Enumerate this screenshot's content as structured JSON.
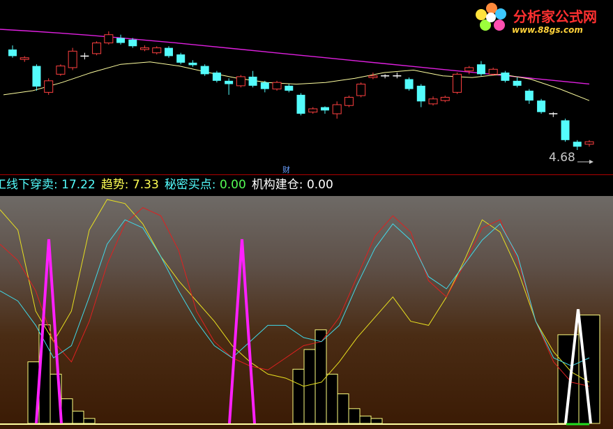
{
  "brand": {
    "name": "分析家公式网",
    "url": "www.88gs.com",
    "colors": {
      "name": "#ff3030",
      "url": "#ffd23a"
    }
  },
  "price_chart": {
    "last_price_label": "4.68",
    "marker_label": "财",
    "colors": {
      "up": "#ff4040",
      "down": "#54fcfc",
      "ma_long": "#e020e0",
      "ma_short": "#ffffa0",
      "ma_mid": "#e0e080",
      "separator": "#b00000"
    },
    "ma_long_values": [
      100,
      99.3,
      98.5,
      97.6,
      96.6,
      95.5,
      94.4,
      93.2,
      92.0,
      90.8,
      89.6,
      88.4,
      87.2,
      86.0,
      84.8,
      83.6,
      82.4,
      81.2,
      80.0,
      78.8,
      77.6
    ],
    "ma_short_values": [
      35,
      40,
      50,
      62,
      72,
      75,
      70,
      62,
      55,
      50,
      48,
      50,
      55,
      62,
      65,
      58,
      56,
      60,
      54,
      42,
      28
    ],
    "candles": [
      {
        "dir": "down",
        "o": 82,
        "c": 90,
        "h": 95,
        "l": 80
      },
      {
        "dir": "up",
        "o": 78,
        "c": 80,
        "h": 82,
        "l": 75
      },
      {
        "dir": "down",
        "o": 70,
        "c": 45,
        "h": 72,
        "l": 40
      },
      {
        "dir": "up",
        "o": 38,
        "c": 52,
        "h": 55,
        "l": 35
      },
      {
        "dir": "up",
        "o": 60,
        "c": 70,
        "h": 72,
        "l": 58
      },
      {
        "dir": "up",
        "o": 68,
        "c": 88,
        "h": 92,
        "l": 65
      },
      {
        "dir": "flat",
        "o": 82,
        "c": 82,
        "h": 86,
        "l": 78
      },
      {
        "dir": "up",
        "o": 85,
        "c": 98,
        "h": 100,
        "l": 83
      },
      {
        "dir": "up",
        "o": 98,
        "c": 108,
        "h": 112,
        "l": 96
      },
      {
        "dir": "down",
        "o": 104,
        "c": 98,
        "h": 108,
        "l": 96
      },
      {
        "dir": "down",
        "o": 102,
        "c": 94,
        "h": 104,
        "l": 92
      },
      {
        "dir": "up",
        "o": 92,
        "c": 90,
        "h": 95,
        "l": 88
      },
      {
        "dir": "up",
        "o": 86,
        "c": 92,
        "h": 94,
        "l": 84
      },
      {
        "dir": "down",
        "o": 92,
        "c": 82,
        "h": 94,
        "l": 80
      },
      {
        "dir": "down",
        "o": 84,
        "c": 74,
        "h": 86,
        "l": 72
      },
      {
        "dir": "down",
        "o": 74,
        "c": 71,
        "h": 77,
        "l": 69
      },
      {
        "dir": "down",
        "o": 70,
        "c": 60,
        "h": 72,
        "l": 58
      },
      {
        "dir": "down",
        "o": 62,
        "c": 52,
        "h": 64,
        "l": 50
      },
      {
        "dir": "down",
        "o": 52,
        "c": 48,
        "h": 55,
        "l": 35
      },
      {
        "dir": "up",
        "o": 46,
        "c": 57,
        "h": 59,
        "l": 44
      },
      {
        "dir": "down",
        "o": 57,
        "c": 46,
        "h": 64,
        "l": 44
      },
      {
        "dir": "down",
        "o": 50,
        "c": 42,
        "h": 52,
        "l": 38
      },
      {
        "dir": "up",
        "o": 42,
        "c": 50,
        "h": 52,
        "l": 40
      },
      {
        "dir": "down",
        "o": 46,
        "c": 40,
        "h": 48,
        "l": 38
      },
      {
        "dir": "down",
        "o": 35,
        "c": 12,
        "h": 37,
        "l": 10
      },
      {
        "dir": "up",
        "o": 14,
        "c": 18,
        "h": 20,
        "l": 12
      },
      {
        "dir": "down",
        "o": 20,
        "c": 16,
        "h": 21,
        "l": 12
      },
      {
        "dir": "up",
        "o": 12,
        "c": 23,
        "h": 27,
        "l": 6
      },
      {
        "dir": "up",
        "o": 22,
        "c": 32,
        "h": 34,
        "l": 20
      },
      {
        "dir": "up",
        "o": 34,
        "c": 48,
        "h": 50,
        "l": 32
      },
      {
        "dir": "up",
        "o": 56,
        "c": 58,
        "h": 62,
        "l": 54
      },
      {
        "dir": "flat",
        "o": 58,
        "c": 58,
        "h": 60,
        "l": 55
      },
      {
        "dir": "flat",
        "o": 58,
        "c": 58,
        "h": 62,
        "l": 55
      },
      {
        "dir": "down",
        "o": 54,
        "c": 42,
        "h": 56,
        "l": 40
      },
      {
        "dir": "down",
        "o": 46,
        "c": 27,
        "h": 48,
        "l": 20
      },
      {
        "dir": "up",
        "o": 24,
        "c": 30,
        "h": 33,
        "l": 22
      },
      {
        "dir": "up",
        "o": 28,
        "c": 32,
        "h": 34,
        "l": 26
      },
      {
        "dir": "up",
        "o": 38,
        "c": 60,
        "h": 62,
        "l": 36
      },
      {
        "dir": "up",
        "o": 64,
        "c": 68,
        "h": 70,
        "l": 60
      },
      {
        "dir": "down",
        "o": 72,
        "c": 60,
        "h": 76,
        "l": 58
      },
      {
        "dir": "up",
        "o": 60,
        "c": 66,
        "h": 68,
        "l": 58
      },
      {
        "dir": "down",
        "o": 62,
        "c": 52,
        "h": 64,
        "l": 50
      },
      {
        "dir": "down",
        "o": 52,
        "c": 46,
        "h": 56,
        "l": 44
      },
      {
        "dir": "down",
        "o": 40,
        "c": 28,
        "h": 42,
        "l": 24
      },
      {
        "dir": "down",
        "o": 28,
        "c": 14,
        "h": 30,
        "l": 12
      },
      {
        "dir": "flat",
        "o": 12,
        "c": 12,
        "h": 14,
        "l": 8
      },
      {
        "dir": "down",
        "o": 4,
        "c": -20,
        "h": 6,
        "l": -22
      },
      {
        "dir": "down",
        "o": -22,
        "c": -28,
        "h": -20,
        "l": -32
      },
      {
        "dir": "up",
        "o": -25,
        "c": -22,
        "h": -20,
        "l": -28
      }
    ]
  },
  "info_bar": [
    {
      "label": "工线下穿卖:",
      "value": "17.22",
      "label_color": "#54fcfc",
      "value_color": "#54fcfc"
    },
    {
      "label": "趋势:",
      "value": "7.33",
      "label_color": "#ffff54",
      "value_color": "#ffff54"
    },
    {
      "label": "秘密买点:",
      "value": "0.00",
      "label_color": "#54fcfc",
      "value_color": "#54fc54"
    },
    {
      "label": "机构建仓:",
      "value": "0.00",
      "label_color": "#ffffff",
      "value_color": "#ffffff"
    }
  ],
  "indicator": {
    "colors": {
      "red": "#e02020",
      "cyan": "#40d8e8",
      "yellow": "#e8e020",
      "magenta": "#ff20ff",
      "white": "#ffffff",
      "green": "#20e020",
      "bar_outline": "#ffff80"
    },
    "red_line": [
      78,
      70,
      55,
      30,
      20,
      40,
      68,
      88,
      96,
      92,
      75,
      45,
      30,
      22,
      18,
      16,
      22,
      28,
      30,
      42,
      62,
      82,
      92,
      84,
      60,
      52,
      68,
      86,
      90,
      70,
      40,
      20,
      10,
      8
    ],
    "cyan_line": [
      55,
      50,
      38,
      22,
      28,
      52,
      78,
      90,
      86,
      72,
      55,
      40,
      28,
      22,
      30,
      38,
      38,
      32,
      30,
      38,
      58,
      76,
      88,
      80,
      62,
      56,
      68,
      80,
      88,
      72,
      40,
      22,
      18,
      22
    ],
    "yellow_line": [
      95,
      85,
      45,
      30,
      45,
      85,
      100,
      98,
      88,
      72,
      60,
      50,
      40,
      28,
      20,
      14,
      12,
      8,
      10,
      20,
      32,
      42,
      52,
      40,
      38,
      52,
      70,
      90,
      84,
      65,
      40,
      25,
      15,
      10
    ],
    "spikes": [
      {
        "color": "magenta",
        "at": 70,
        "height": 100
      },
      {
        "color": "magenta",
        "at": 347,
        "height": 100
      },
      {
        "color": "white",
        "at": 829,
        "height": 62
      }
    ],
    "bars": [
      {
        "group": 1,
        "heights": [
          25,
          40,
          20,
          10,
          5,
          2
        ]
      },
      {
        "group": 2,
        "heights": [
          22,
          30,
          38,
          20,
          12,
          6,
          3,
          2
        ]
      },
      {
        "group": 3,
        "heights": [
          36,
          44
        ]
      }
    ]
  }
}
